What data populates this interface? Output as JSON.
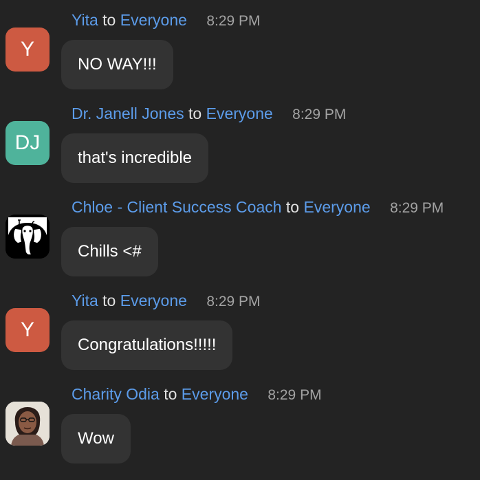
{
  "messages": [
    {
      "sender": "Yita",
      "to": "to",
      "recipient": "Everyone",
      "time": "8:29 PM",
      "avatar_initials": "Y",
      "avatar_color": "#cd5a42",
      "text": "NO WAY!!!"
    },
    {
      "sender": "Dr. Janell Jones",
      "to": "to",
      "recipient": "Everyone",
      "time": "8:29 PM",
      "avatar_initials": "DJ",
      "avatar_color": "#4fb39b",
      "text": "that's incredible"
    },
    {
      "sender": "Chloe - Client Success Coach",
      "to": "to",
      "recipient": "Everyone",
      "time": "8:29 PM",
      "avatar_icon": "elephant-logo-icon",
      "text": "Chills <#"
    },
    {
      "sender": "Yita",
      "to": "to",
      "recipient": "Everyone",
      "time": "8:29 PM",
      "avatar_initials": "Y",
      "avatar_color": "#cd5a42",
      "text": "Congratulations!!!!!"
    },
    {
      "sender": "Charity Odia",
      "to": "to",
      "recipient": "Everyone",
      "time": "8:29 PM",
      "avatar_icon": "user-photo-icon",
      "text": "Wow"
    }
  ],
  "colors": {
    "background": "#232323",
    "bubble": "#333333",
    "name_link": "#5c9cea",
    "time": "#a3a3a3"
  }
}
